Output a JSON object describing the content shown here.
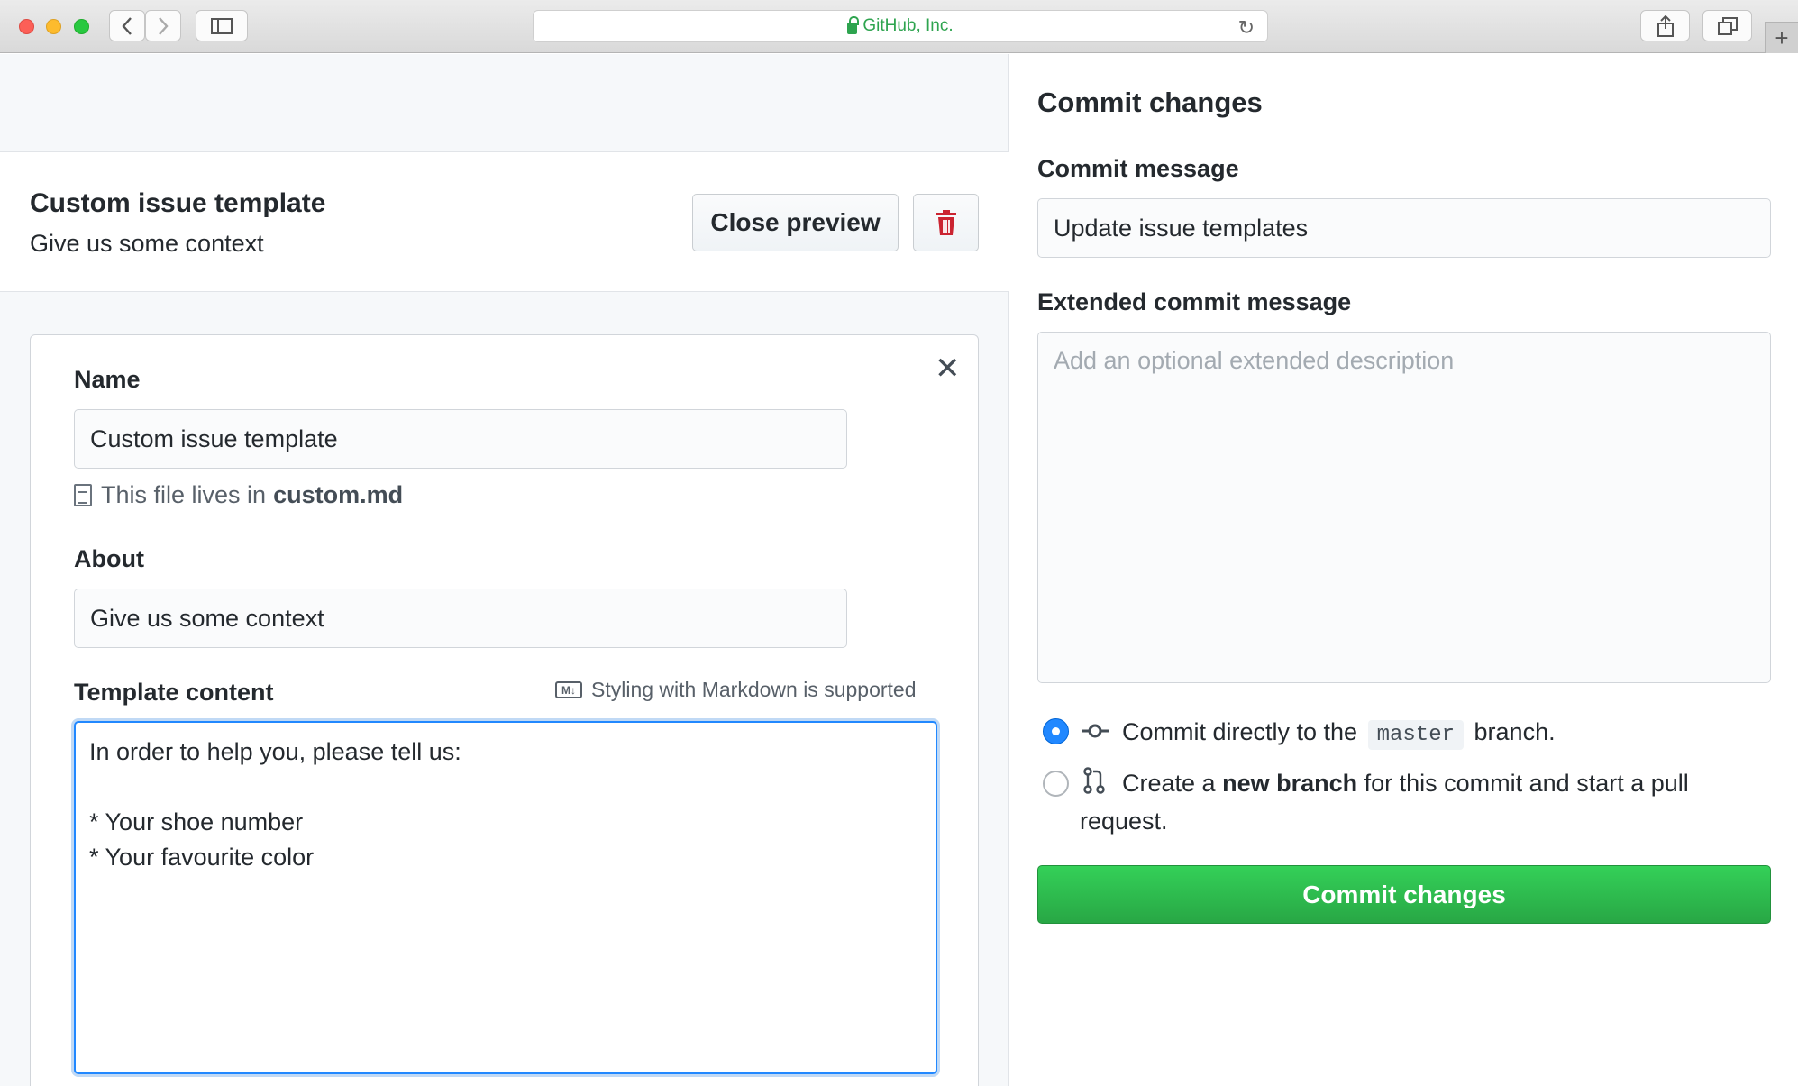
{
  "browser": {
    "url_label": "GitHub, Inc.",
    "back_icon": "chevron-left-icon",
    "forward_icon": "chevron-right-icon"
  },
  "header": {
    "title": "Custom issue template",
    "subtitle": "Give us some context",
    "close_preview_label": "Close preview"
  },
  "form": {
    "name_label": "Name",
    "name_value": "Custom issue template",
    "file_note_prefix": "This file lives in",
    "file_name": "custom.md",
    "about_label": "About",
    "about_value": "Give us some context",
    "template_label": "Template content",
    "markdown_hint": "Styling with Markdown is supported",
    "template_value": "In order to help you, please tell us:\n\n* Your shoe number\n* Your favourite color"
  },
  "commit": {
    "title": "Commit changes",
    "message_label": "Commit message",
    "message_value": "Update issue templates",
    "extended_label": "Extended commit message",
    "extended_placeholder": "Add an optional extended description",
    "option_direct_prefix": "Commit directly to the",
    "option_direct_branch": "master",
    "option_direct_suffix": "branch.",
    "option_new_prefix": "Create a",
    "option_new_bold": "new branch",
    "option_new_suffix": "for this commit and start a pull",
    "option_new_suffix2": "request.",
    "button_label": "Commit changes",
    "button_color": "#2ea44f"
  }
}
